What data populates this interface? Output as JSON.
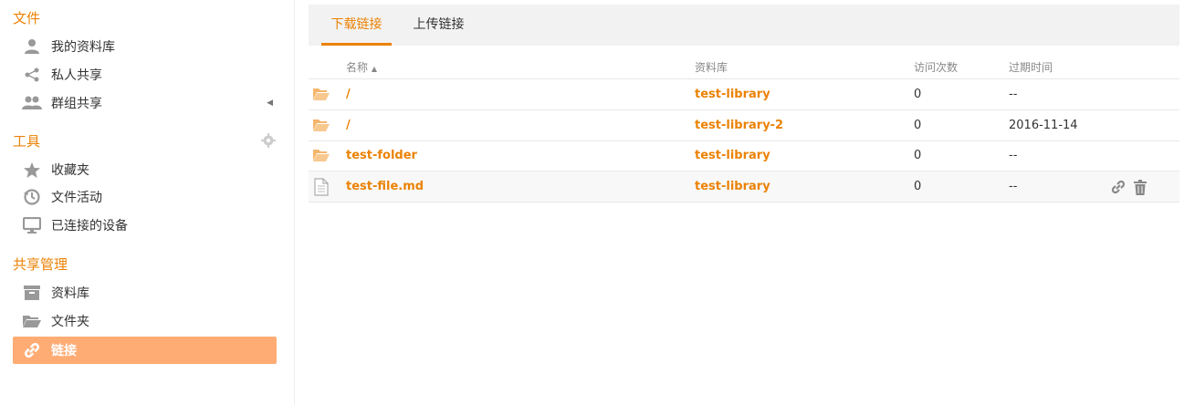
{
  "sidebar": {
    "sections": [
      {
        "title": "文件",
        "items": [
          {
            "label": "我的资料库",
            "icon": "user-icon"
          },
          {
            "label": "私人共享",
            "icon": "share-icon"
          },
          {
            "label": "群组共享",
            "icon": "group-icon"
          }
        ]
      },
      {
        "title": "工具",
        "items": [
          {
            "label": "收藏夹",
            "icon": "star-icon"
          },
          {
            "label": "文件活动",
            "icon": "history-icon"
          },
          {
            "label": "已连接的设备",
            "icon": "monitor-icon"
          }
        ]
      },
      {
        "title": "共享管理",
        "items": [
          {
            "label": "资料库",
            "icon": "archive-icon"
          },
          {
            "label": "文件夹",
            "icon": "folder-open-icon"
          },
          {
            "label": "链接",
            "icon": "link-icon"
          }
        ]
      }
    ]
  },
  "tabs": [
    "下载链接",
    "上传链接"
  ],
  "table": {
    "headers": {
      "name": "名称",
      "library": "资料库",
      "visits": "访问次数",
      "expire": "过期时间"
    },
    "sort_indicator": "▲",
    "rows": [
      {
        "type": "folder",
        "name": "/",
        "library": "test-library",
        "visits": "0",
        "expire": "--"
      },
      {
        "type": "folder",
        "name": "/",
        "library": "test-library-2",
        "visits": "0",
        "expire": "2016-11-14"
      },
      {
        "type": "folder",
        "name": "test-folder",
        "library": "test-library",
        "visits": "0",
        "expire": "--"
      },
      {
        "type": "file",
        "name": "test-file.md",
        "library": "test-library",
        "visits": "0",
        "expire": "--"
      }
    ]
  },
  "colors": {
    "accent": "#eb8205",
    "active_bg": "#feac74",
    "folder": "#f5b56b"
  }
}
